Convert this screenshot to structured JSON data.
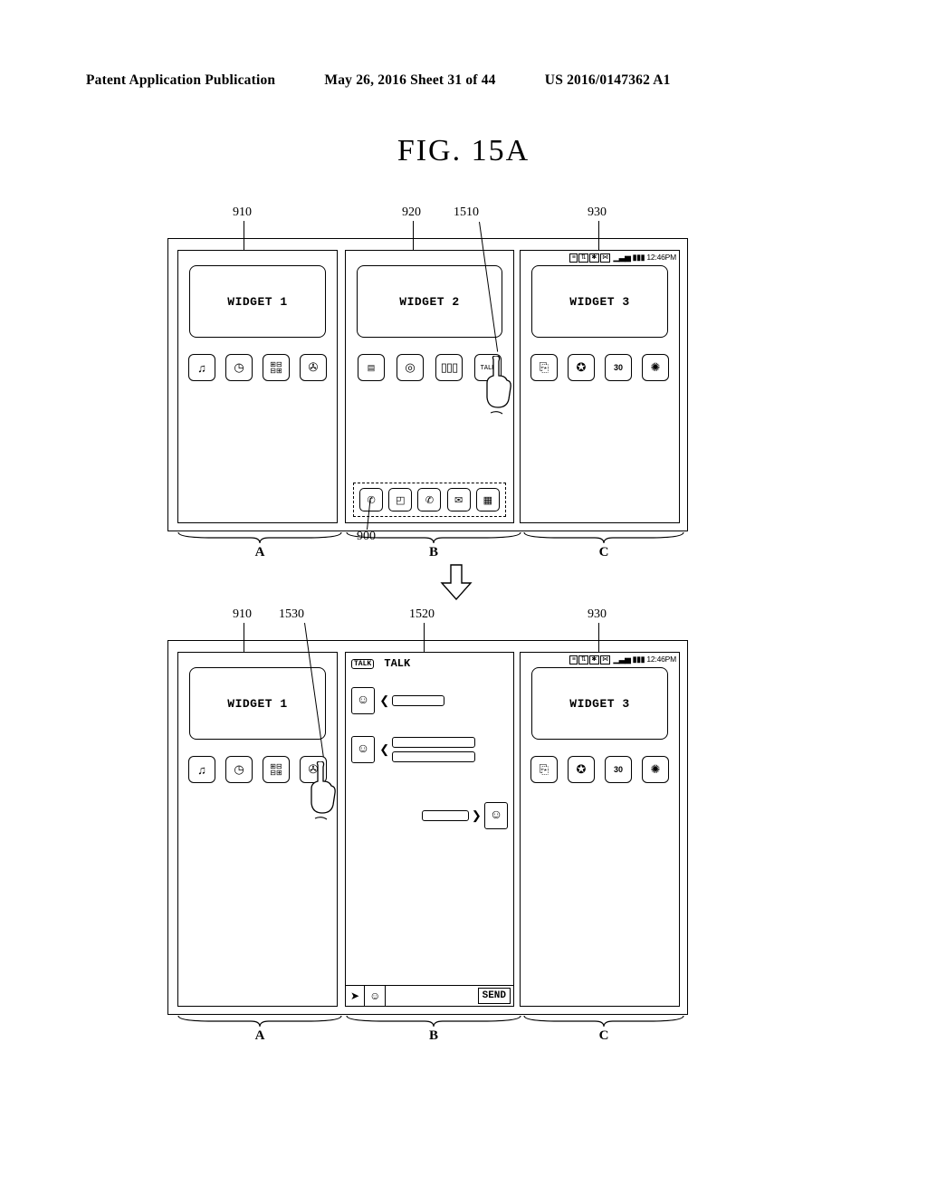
{
  "header": {
    "left": "Patent Application Publication",
    "mid": "May 26, 2016  Sheet 31 of 44",
    "right": "US 2016/0147362 A1"
  },
  "figure_title": "FIG.  15A",
  "refs": {
    "r910": "910",
    "r920": "920",
    "r930": "930",
    "r1510": "1510",
    "r900": "900",
    "r1520": "1520",
    "r1530": "1530"
  },
  "widgets": {
    "w1": "WIDGET 1",
    "w2": "WIDGET 2",
    "w3": "WIDGET 3"
  },
  "status_bar": {
    "time": "12:46PM"
  },
  "dock_icons": {
    "calendar_num": "30"
  },
  "braces": {
    "a": "A",
    "b": "B",
    "c": "C"
  },
  "talk": {
    "title": "TALK",
    "send": "SEND"
  }
}
